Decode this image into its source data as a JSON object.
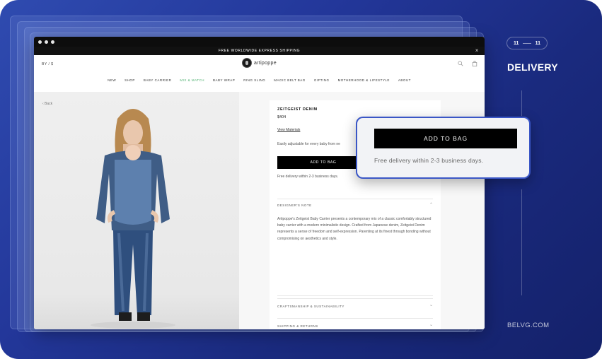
{
  "browser": {
    "promo_text": "FREE WORLDWIDE EXPRESS SHIPPING",
    "promo_close": "×"
  },
  "site": {
    "lang": "BY / $",
    "logo_text": "artipoppe",
    "search_icon": "search-icon",
    "bag_icon": "bag-icon",
    "nav": [
      "NEW",
      "SHOP",
      "BABY CARRIER",
      "MIX & MATCH",
      "BABY WRAP",
      "RING SLING",
      "MAGIC BELT BAG",
      "GIFTING",
      "MOTHERHOOD & LIFESTYLE",
      "ABOUT"
    ],
    "nav_active_color": "#4caf6e",
    "back": "‹ Back"
  },
  "product": {
    "title": "ZEITGEIST DENIM",
    "price": "$404",
    "materials_link": "View Materials",
    "description": "Easily adjustable for every baby from ne",
    "add_to_bag": "ADD TO BAG",
    "delivery": "Free delivery within 2-3 business days.",
    "designers_note_heading": "DESIGNER'S NOTE",
    "designers_note_body": "Artipoppe's Zeitgeist Baby Carrier presents a contemporary mix of a classic comfortably structured baby carrier with a modern minimalistic design. Crafted from Japanese denim, Zeitgeist Denim represents a sense of freedom and self-expression. Parenting at its finest through bonding without compromising on aesthetics and style.",
    "accordion": [
      "PRODUCT SIZE & DETAILS",
      "EASY TO USE FROM BIRTH",
      "CRAFTSMANSHIP & SUSTAINABILITY",
      "SHIPPING & RETURNS"
    ],
    "chevron": "⌄"
  },
  "popup": {
    "button": "ADD TO BAG",
    "text": "Free delivery within 2-3 business days."
  },
  "slide": {
    "current": "11",
    "total": "11",
    "title": "DELIVERY",
    "brand": "BELVG.COM"
  },
  "colors": {
    "background": "#1f3190",
    "accent_border": "#3a56c6"
  }
}
